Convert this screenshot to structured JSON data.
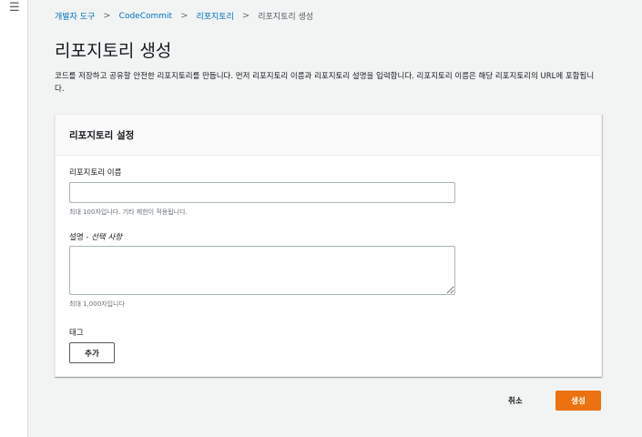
{
  "nav": {
    "menu_icon": "☰"
  },
  "breadcrumb": {
    "items": [
      "개발자 도구",
      "CodeCommit",
      "리포지토리"
    ],
    "current": "리포지토리 생성",
    "separator": ">"
  },
  "page": {
    "title": "리포지토리 생성",
    "description": "코드를 저장하고 공유할 안전한 리포지토리를 만듭니다. 먼저 리포지토리 이름과 리포지토리 설명을 입력합니다. 리포지토리 이름은 해당 리포지토리의 URL에 포함됩니다."
  },
  "settings": {
    "header": "리포지토리 설정",
    "name_label": "리포지토리 이름",
    "name_value": "",
    "name_hint": "최대 100자입니다. 기타 제한이 적용됩니다.",
    "desc_label": "설명",
    "desc_optional": " - 선택 사항",
    "desc_value": "",
    "desc_hint": "최대 1,000자입니다",
    "tags_label": "태그",
    "add_label": "추가"
  },
  "actions": {
    "cancel_label": "취소",
    "create_label": "생성"
  },
  "colors": {
    "primary": "#ec7211",
    "link": "#0073bb",
    "background": "#f2f3f3"
  }
}
